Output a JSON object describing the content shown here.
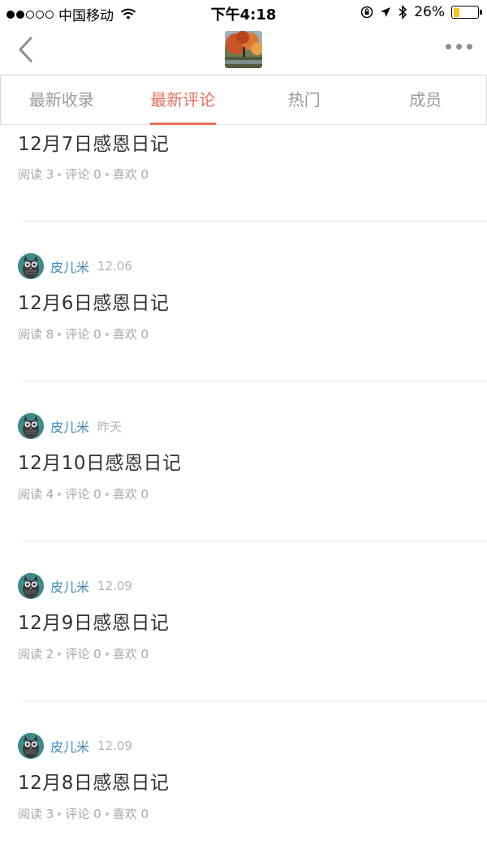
{
  "status_bar": {
    "carrier": "中国移动",
    "time": "下午4:18",
    "battery_percent": "26%",
    "battery_level": 0.26,
    "battery_color": "#f5c518"
  },
  "nav": {
    "back_icon": "chevron-left-icon",
    "more_icon": "ellipsis-icon",
    "collection_thumbnail": "autumn-tree-photo"
  },
  "tabs": [
    {
      "label": "最新收录",
      "active": false
    },
    {
      "label": "最新评论",
      "active": true
    },
    {
      "label": "热门",
      "active": false
    },
    {
      "label": "成员",
      "active": false
    }
  ],
  "accent_color": "#ea6f5a",
  "author_color": "#3f8bbd",
  "articles": [
    {
      "author": "",
      "time": "",
      "title": "12月7日感恩日记",
      "stats": {
        "read_label": "阅读",
        "read": "3",
        "comment_label": "评论",
        "comment": "0",
        "like_label": "喜欢",
        "like": "0"
      }
    },
    {
      "author": "皮儿米",
      "time": "12.06",
      "title": "12月6日感恩日记",
      "stats": {
        "read_label": "阅读",
        "read": "8",
        "comment_label": "评论",
        "comment": "0",
        "like_label": "喜欢",
        "like": "0"
      }
    },
    {
      "author": "皮儿米",
      "time": "昨天",
      "title": "12月10日感恩日记",
      "stats": {
        "read_label": "阅读",
        "read": "4",
        "comment_label": "评论",
        "comment": "0",
        "like_label": "喜欢",
        "like": "0"
      }
    },
    {
      "author": "皮儿米",
      "time": "12.09",
      "title": "12月9日感恩日记",
      "stats": {
        "read_label": "阅读",
        "read": "2",
        "comment_label": "评论",
        "comment": "0",
        "like_label": "喜欢",
        "like": "0"
      }
    },
    {
      "author": "皮儿米",
      "time": "12.09",
      "title": "12月8日感恩日记",
      "stats": {
        "read_label": "阅读",
        "read": "3",
        "comment_label": "评论",
        "comment": "0",
        "like_label": "喜欢",
        "like": "0"
      }
    }
  ]
}
